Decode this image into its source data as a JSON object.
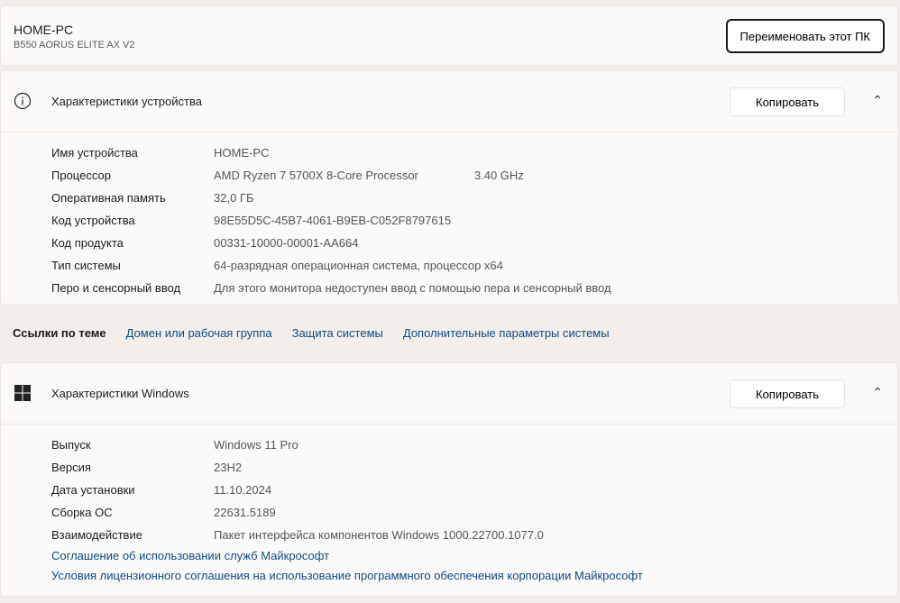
{
  "top": {
    "pc_name": "HOME-PC",
    "model": "B550 AORUS ELITE AX V2",
    "rename_label": "Переименовать этот ПК"
  },
  "device": {
    "title": "Характеристики устройства",
    "copy_label": "Копировать",
    "rows": [
      {
        "k": "Имя устройства",
        "v": "HOME-PC"
      },
      {
        "k": "Процессор",
        "v": "AMD Ryzen 7 5700X 8-Core Processor",
        "extra": "3.40 GHz"
      },
      {
        "k": "Оперативная память",
        "v": "32,0 ГБ"
      },
      {
        "k": "Код устройства",
        "v": "98E55D5C-45B7-4061-B9EB-C052F8797615"
      },
      {
        "k": "Код продукта",
        "v": "00331-10000-00001-AA664"
      },
      {
        "k": "Тип системы",
        "v": "64-разрядная операционная система, процессор x64"
      },
      {
        "k": "Перо и сенсорный ввод",
        "v": "Для этого монитора недоступен ввод с помощью пера и сенсорный ввод"
      }
    ]
  },
  "related": {
    "label": "Ссылки по теме",
    "links": [
      "Домен или рабочая группа",
      "Защита системы",
      "Дополнительные параметры системы"
    ]
  },
  "windows": {
    "title": "Характеристики Windows",
    "copy_label": "Копировать",
    "rows": [
      {
        "k": "Выпуск",
        "v": "Windows 11 Pro"
      },
      {
        "k": "Версия",
        "v": "23H2"
      },
      {
        "k": "Дата установки",
        "v": "11.10.2024"
      },
      {
        "k": "Сборка ОС",
        "v": "22631.5189"
      },
      {
        "k": "Взаимодействие",
        "v": "Пакет интерфейса компонентов Windows 1000.22700.1077.0"
      }
    ],
    "links": [
      "Соглашение об использовании служб Майкрософт",
      "Условия лицензионного соглашения на использование программного обеспечения корпорации Майкрософт"
    ]
  }
}
